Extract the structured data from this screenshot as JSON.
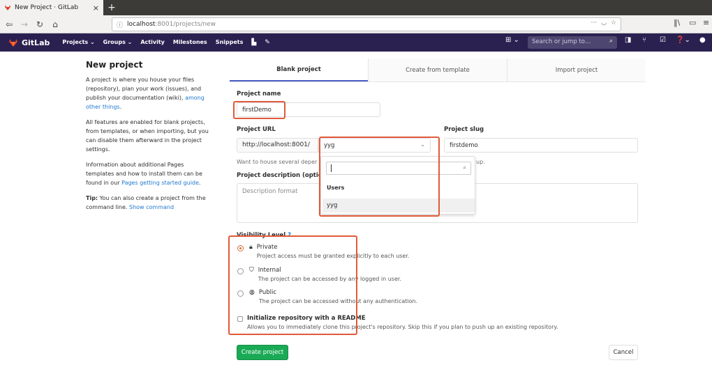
{
  "browser": {
    "tab_title": "New Project · GitLab",
    "url_host": "localhost",
    "url_path": ":8001/projects/new"
  },
  "header": {
    "brand": "GitLab",
    "nav": [
      "Projects ⌄",
      "Groups ⌄",
      "Activity",
      "Milestones",
      "Snippets"
    ],
    "search_placeholder": "Search or jump to…"
  },
  "left": {
    "title": "New project",
    "p1_text": "A project is where you house your files (repository), plan your work (issues), and publish your documentation (wiki), ",
    "p1_link": "among other things",
    "p1_end": ".",
    "p2": "All features are enabled for blank projects, from templates, or when importing, but you can disable them afterward in the project settings.",
    "p3_text": "Information about additional Pages templates and how to install them can be found in our ",
    "p3_link": "Pages getting started guide",
    "p3_end": ".",
    "p4_bold": "Tip:",
    "p4_text": " You can also create a project from the command line. ",
    "p4_link": "Show command"
  },
  "tabs": [
    "Blank project",
    "Create from template",
    "Import project"
  ],
  "form": {
    "name_label": "Project name",
    "name_value": "firstDemo",
    "url_label": "Project URL",
    "url_prefix": "http://localhost:8001/",
    "namespace_value": "yyg",
    "slug_label": "Project slug",
    "slug_value": "firstdemo",
    "help_text": "Want to house several deper",
    "help_tail": "up.",
    "desc_label": "Project description (option",
    "desc_placeholder": "Description format",
    "dropdown": {
      "header": "Users",
      "item": "yyg"
    },
    "visibility_label": "Visibility Level",
    "visibility": [
      {
        "title": "Private",
        "desc": "Project access must be granted explicitly to each user.",
        "selected": true
      },
      {
        "title": "Internal",
        "desc": "The project can be accessed by any logged in user.",
        "selected": false
      },
      {
        "title": "Public",
        "desc": "The project can be accessed without any authentication.",
        "selected": false
      }
    ],
    "readme_label": "Initialize repository with a README",
    "readme_desc": "Allows you to immediately clone this project's repository. Skip this if you plan to push up an existing repository.",
    "create_label": "Create project",
    "cancel_label": "Cancel"
  },
  "colors": {
    "header_bg": "#2b2151",
    "accent_tab": "#4b5cc4",
    "create_green": "#1aaa55",
    "highlight_red": "#e05a3a",
    "link": "#1f78d1"
  }
}
